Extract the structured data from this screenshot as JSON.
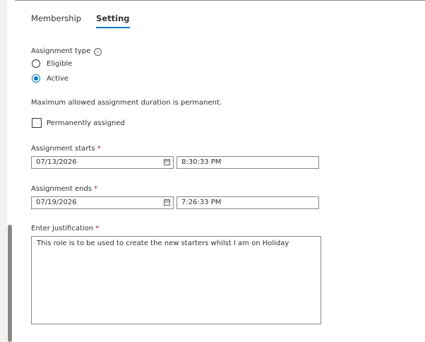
{
  "tabs": [
    {
      "label": "Membership",
      "active": false
    },
    {
      "label": "Setting",
      "active": true
    }
  ],
  "assignment_type": {
    "label": "Assignment type",
    "info_icon": "i",
    "options": [
      {
        "label": "Eligible",
        "checked": false
      },
      {
        "label": "Active",
        "checked": true
      }
    ]
  },
  "duration_note": "Maximum allowed assignment duration is permanent.",
  "permanent": {
    "label": "Permanently assigned",
    "checked": false
  },
  "starts": {
    "label": "Assignment starts",
    "required_mark": "*",
    "date": "07/13/2026",
    "time": "8:30:33 PM"
  },
  "ends": {
    "label": "Assignment ends",
    "required_mark": "*",
    "date": "07/19/2026",
    "time": "7:26:33 PM"
  },
  "justification": {
    "label": "Enter justification",
    "required_mark": "*",
    "value": "This role is to be used to create the new starters whilst I am on Holiday"
  },
  "colors": {
    "accent": "#0078d4",
    "required": "#a4262c",
    "text": "#323130",
    "border": "#8a8886"
  }
}
